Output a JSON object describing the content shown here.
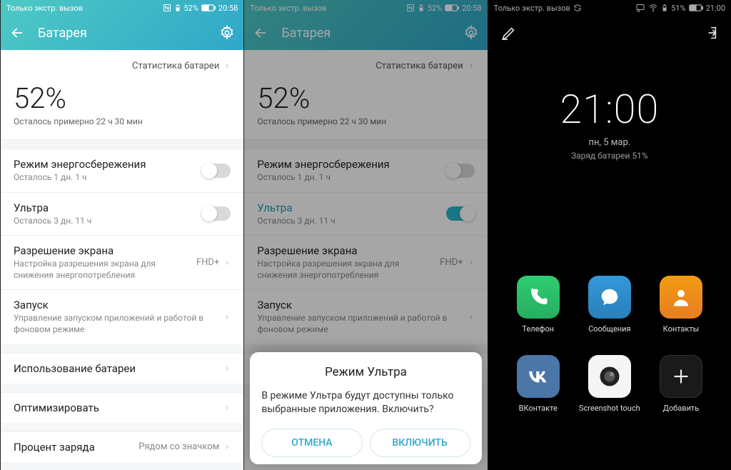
{
  "p1": {
    "status_left": "Только экстр. вызов",
    "status_pct": "52%",
    "status_time": "20:58",
    "appbar_title": "Батарея",
    "stats_link": "Статистика батареи",
    "big_pct": "52%",
    "remaining": "Осталось примерно 22 ч 30 мин",
    "row_ps_title": "Режим энергосбережения",
    "row_ps_sub": "Осталось 1 дн. 1 ч",
    "row_ultra_title": "Ультра",
    "row_ultra_sub": "Осталось 3 дн. 11 ч",
    "row_res_title": "Разрешение экрана",
    "row_res_sub": "Настройка разрешения экрана для снижения энергопотребления",
    "row_res_val": "FHD+",
    "row_launch_title": "Запуск",
    "row_launch_sub": "Управление запуском приложений и работой в фоновом режиме",
    "row_usage_title": "Использование батареи",
    "row_opt_title": "Оптимизировать",
    "row_pct_title": "Процент заряда",
    "row_pct_val": "Рядом со значком"
  },
  "p2": {
    "dialog_title": "Режим Ультра",
    "dialog_body": "В режиме Ультра будут доступны только выбранные приложения. Включить?",
    "btn_cancel": "ОТМЕНА",
    "btn_enable": "ВКЛЮЧИТЬ"
  },
  "p3": {
    "status_left": "Только экстр. вызов",
    "status_pct": "51%",
    "status_time": "21:00",
    "big_time": "21:00",
    "date": "пн, 5 мар.",
    "charge": "Заряд батареи 51%",
    "apps": [
      {
        "label": "Телефон"
      },
      {
        "label": "Сообщения"
      },
      {
        "label": "Контакты"
      },
      {
        "label": "ВКонтакте"
      },
      {
        "label": "Screenshot touch"
      },
      {
        "label": "Добавить"
      }
    ]
  }
}
